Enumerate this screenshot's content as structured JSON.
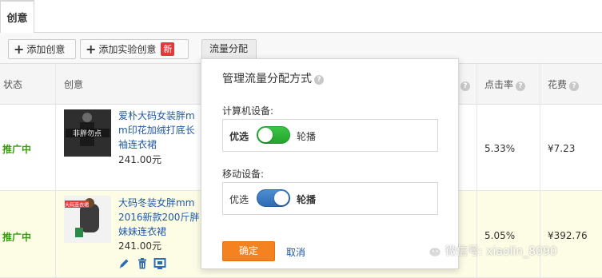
{
  "tabs": [
    {
      "label": "创意"
    }
  ],
  "toolbar": {
    "add_creative": "添加创意",
    "add_experiment": "添加实验创意",
    "new_badge": "新",
    "traffic": "流量分配"
  },
  "table": {
    "headers": {
      "status": "状态",
      "creative": "创意",
      "ctr": "点击率",
      "cost": "花费"
    },
    "rows": [
      {
        "status": "推广中",
        "title": "爱朴大码女装胖mm印花加绒打底长袖连衣裙",
        "title_lines": [
          "爱朴大码女装胖m",
          "m印花加绒打底长",
          "袖连衣裙"
        ],
        "price": "241.00元",
        "thumb_text": "非胖勿点",
        "ctr": "5.33%",
        "cost": "¥7.23"
      },
      {
        "status": "推广中",
        "title": "大码冬装女胖mm2016新款200斤胖妹妹连衣裙",
        "title_lines": [
          "大码冬装女胖mm",
          "2016新款200斤胖",
          "妹妹连衣裙"
        ],
        "price": "241.00元",
        "thumb_text": "大码连衣裙",
        "ctr": "5.05%",
        "cost": "¥392.76"
      }
    ]
  },
  "popover": {
    "title": "管理流量分配方式",
    "pc_label": "计算机设备:",
    "pc_left": "优选",
    "pc_right": "轮播",
    "mobile_label": "移动设备:",
    "mobile_left": "优选",
    "mobile_right": "轮播",
    "confirm": "确定",
    "cancel": "取消"
  },
  "watermark": "微信号: xiaolin_8090",
  "colors": {
    "status_green": "#3a9b0e",
    "link_blue": "#1f58a3",
    "confirm_orange": "#f58220",
    "toggle_green": "#23a52d",
    "toggle_blue": "#2d6cb5"
  }
}
